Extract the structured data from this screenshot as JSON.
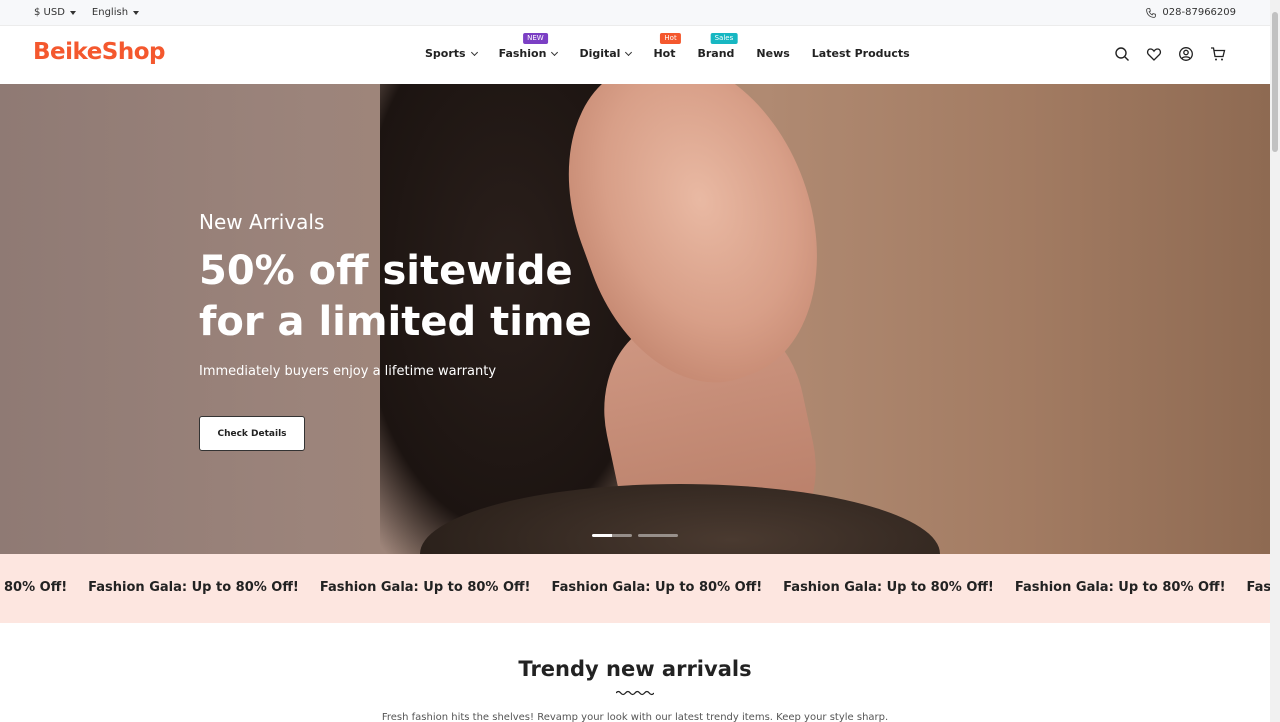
{
  "topbar": {
    "currency": "$ USD",
    "language": "English",
    "phone": "028-87966209"
  },
  "header": {
    "logo": "BeikeShop",
    "brand_color": "#f4582e",
    "nav": [
      {
        "label": "Sports",
        "dropdown": true,
        "badge": ""
      },
      {
        "label": "Fashion",
        "dropdown": true,
        "badge": "NEW"
      },
      {
        "label": "Digital",
        "dropdown": true,
        "badge": ""
      },
      {
        "label": "Hot",
        "dropdown": false,
        "badge": "Hot"
      },
      {
        "label": "Brand",
        "dropdown": false,
        "badge": "Sales"
      },
      {
        "label": "News",
        "dropdown": false,
        "badge": ""
      },
      {
        "label": "Latest Products",
        "dropdown": false,
        "badge": ""
      }
    ],
    "icons": [
      "search-icon",
      "heart-icon",
      "user-icon",
      "cart-icon"
    ]
  },
  "hero": {
    "subtitle": "New Arrivals",
    "title": "50% off sitewide for a limited time",
    "description": "Immediately buyers enjoy a lifetime warranty",
    "button": "Check Details",
    "slides": 2,
    "active_slide": 1
  },
  "marquee": {
    "lead": "80% Off!",
    "items": [
      "Fashion Gala: Up to 80% Off!",
      "Fashion Gala: Up to 80% Off!",
      "Fashion Gala: Up to 80% Off!",
      "Fashion Gala: Up to 80% Off!",
      "Fashion Gala: Up to 80% Off!",
      "Fashion Gala: U"
    ]
  },
  "section": {
    "title": "Trendy new arrivals",
    "description": "Fresh fashion hits the shelves! Revamp your look with our latest trendy items. Keep your style sharp."
  }
}
